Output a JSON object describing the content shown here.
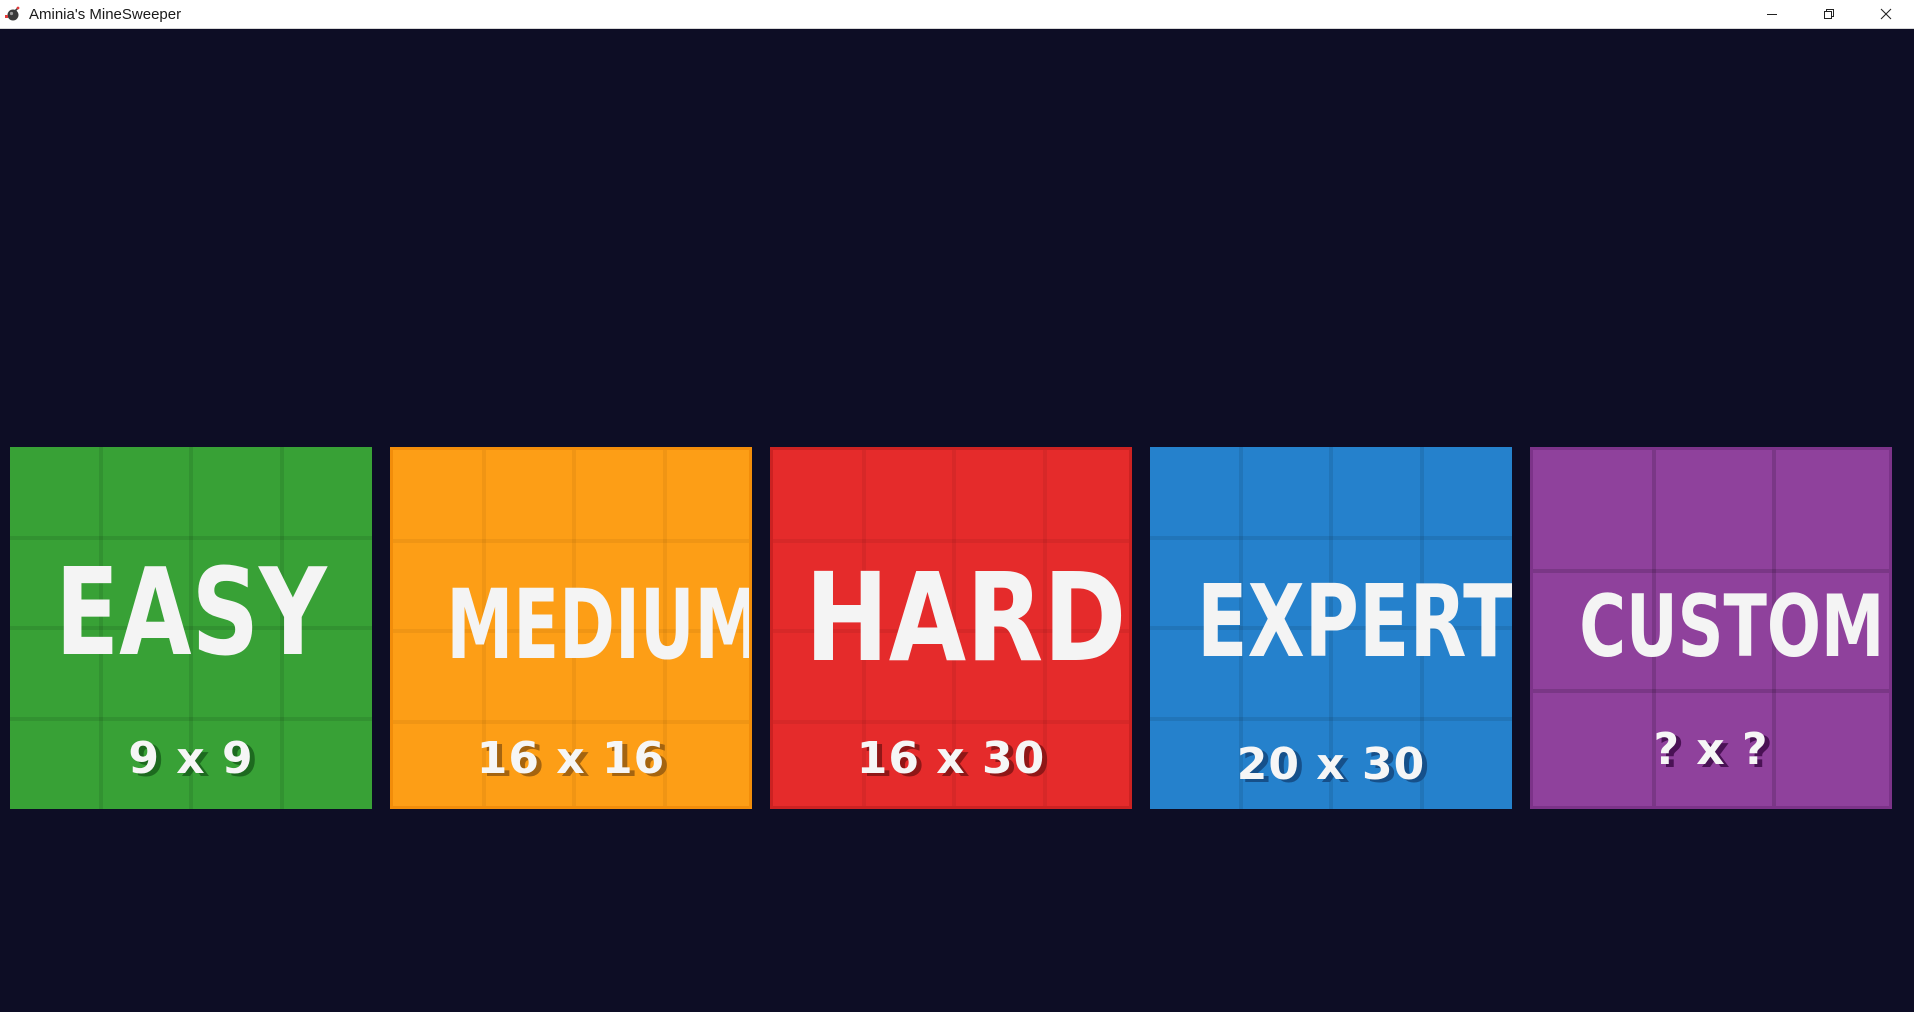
{
  "window": {
    "title": "Aminia's MineSweeper",
    "minimize_icon": "minimize-icon",
    "maximize_icon": "restore-icon",
    "close_icon": "close-icon"
  },
  "theme": {
    "background": "#0d0d25"
  },
  "difficulties": [
    {
      "label": "EASY",
      "size": "9 x 9",
      "color": "#38a136",
      "grid": [
        4,
        4
      ]
    },
    {
      "label": "MEDIUM",
      "size": "16 x 16",
      "color": "#fd9e16",
      "grid": [
        4,
        4
      ]
    },
    {
      "label": "HARD",
      "size": "16 x 30",
      "color": "#e52b2b",
      "grid": [
        4,
        4
      ]
    },
    {
      "label": "EXPERT",
      "size": "20 x 30",
      "color": "#2581cc",
      "grid": [
        4,
        4
      ]
    },
    {
      "label": "CUSTOM",
      "size": "? x ?",
      "color": "#8f419c",
      "grid": [
        3,
        3
      ]
    }
  ]
}
